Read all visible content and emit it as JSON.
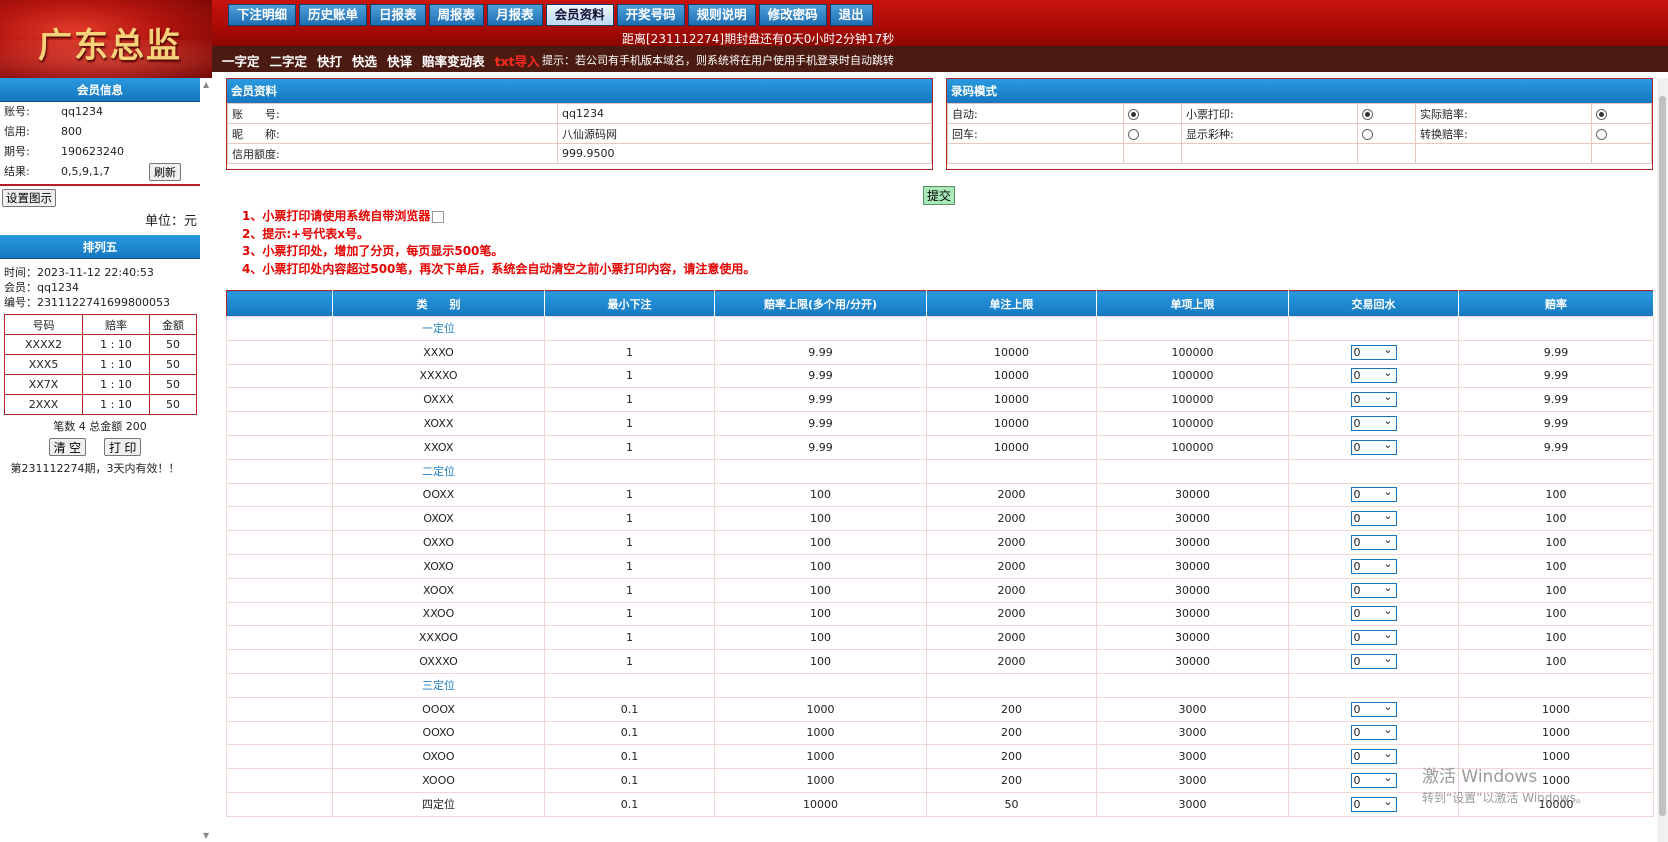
{
  "logo": "广东总监",
  "nav": [
    "下注明细",
    "历史账单",
    "日报表",
    "周报表",
    "月报表",
    "会员资料",
    "开奖号码",
    "规则说明",
    "修改密码",
    "退出"
  ],
  "countdown": "距离[231112274]期封盘还有0天0小时2分钟17秒",
  "quick": [
    "一字定",
    "二字定",
    "快打",
    "快选",
    "快译",
    "赔率变动表"
  ],
  "quick_red": "txt导入",
  "tip": "提示：若公司有手机版本域名，则系统将在用户使用手机登录时自动跳转",
  "sidebar": {
    "title": "会员信息",
    "account_k": "账号:",
    "account_v": "qq1234",
    "credit_k": "信用:",
    "credit_v": "800",
    "period_k": "期号:",
    "period_v": "190623240",
    "result_k": "结果:",
    "result_v": "0,5,9,1,7",
    "refresh": "刷新",
    "settings": "设置图示",
    "unit": "单位：元",
    "pl5_title": "排列五",
    "time": "时间：2023-11-12 22:40:53",
    "member": "会员：qq1234",
    "serial": "编号：2311122741699800053",
    "ticket_headers": [
      "号码",
      "赔率",
      "金额"
    ],
    "tickets": [
      [
        "XXXX2",
        "1 : 10",
        "50"
      ],
      [
        "XXX5",
        "1 : 10",
        "50"
      ],
      [
        "XX7X",
        "1 : 10",
        "50"
      ],
      [
        "2XXX",
        "1 : 10",
        "50"
      ]
    ],
    "summary": "笔数 4 总金额 200",
    "clear": "清 空",
    "print": "打 印",
    "valid": "第231112274期，3天内有效！！"
  },
  "member_panel": {
    "title": "会员资料",
    "rows": [
      [
        "账　　号:",
        "qq1234"
      ],
      [
        "昵　　称:",
        "八仙源码网"
      ],
      [
        "信用额度:",
        "999.9500"
      ]
    ]
  },
  "mode_panel": {
    "title": "录码模式",
    "row1": [
      "自动:",
      "小票打印:",
      "实际赔率:"
    ],
    "row2": [
      "回车:",
      "显示彩种:",
      "转换赔率:"
    ]
  },
  "submit": "提交",
  "notes": [
    "1、小票打印请使用系统自带浏览器",
    "2、提示:+号代表x号。",
    "3、小票打印处，增加了分页，每页显示500笔。",
    "4、小票打印处内容超过500笔，再次下单后，系统会自动清空之前小票打印内容，请注意使用。"
  ],
  "odds": {
    "headers": [
      "",
      "类　　别",
      "最小下注",
      "赔率上限(多个用/分开)",
      "单注上限",
      "单项上限",
      "交易回水",
      "赔率"
    ],
    "groups": [
      {
        "name": "一定位",
        "rows": [
          [
            "XXXO",
            "1",
            "9.99",
            "10000",
            "100000",
            "0",
            "9.99"
          ],
          [
            "XXXXO",
            "1",
            "9.99",
            "10000",
            "100000",
            "0",
            "9.99"
          ],
          [
            "OXXX",
            "1",
            "9.99",
            "10000",
            "100000",
            "0",
            "9.99"
          ],
          [
            "XOXX",
            "1",
            "9.99",
            "10000",
            "100000",
            "0",
            "9.99"
          ],
          [
            "XXOX",
            "1",
            "9.99",
            "10000",
            "100000",
            "0",
            "9.99"
          ]
        ]
      },
      {
        "name": "二定位",
        "rows": [
          [
            "OOXX",
            "1",
            "100",
            "2000",
            "30000",
            "0",
            "100"
          ],
          [
            "OXOX",
            "1",
            "100",
            "2000",
            "30000",
            "0",
            "100"
          ],
          [
            "OXXO",
            "1",
            "100",
            "2000",
            "30000",
            "0",
            "100"
          ],
          [
            "XOXO",
            "1",
            "100",
            "2000",
            "30000",
            "0",
            "100"
          ],
          [
            "XOOX",
            "1",
            "100",
            "2000",
            "30000",
            "0",
            "100"
          ],
          [
            "XXOO",
            "1",
            "100",
            "2000",
            "30000",
            "0",
            "100"
          ],
          [
            "XXXOO",
            "1",
            "100",
            "2000",
            "30000",
            "0",
            "100"
          ],
          [
            "OXXXO",
            "1",
            "100",
            "2000",
            "30000",
            "0",
            "100"
          ]
        ]
      },
      {
        "name": "三定位",
        "rows": [
          [
            "OOOX",
            "0.1",
            "1000",
            "200",
            "3000",
            "0",
            "1000"
          ],
          [
            "OOXO",
            "0.1",
            "1000",
            "200",
            "3000",
            "0",
            "1000"
          ],
          [
            "OXOO",
            "0.1",
            "1000",
            "200",
            "3000",
            "0",
            "1000"
          ],
          [
            "XOOO",
            "0.1",
            "1000",
            "200",
            "3000",
            "0",
            "1000"
          ],
          [
            "四定位",
            "0.1",
            "10000",
            "50",
            "3000",
            "0",
            "10000"
          ]
        ]
      }
    ]
  },
  "watermark": {
    "line1": "激活 Windows",
    "line2": "转到“设置”以激活 Windows。"
  },
  "colors": {
    "header_red": "#a90a05",
    "panel_blue": "#1577bf",
    "border_red": "#b3242a",
    "note_red": "#e60000"
  }
}
